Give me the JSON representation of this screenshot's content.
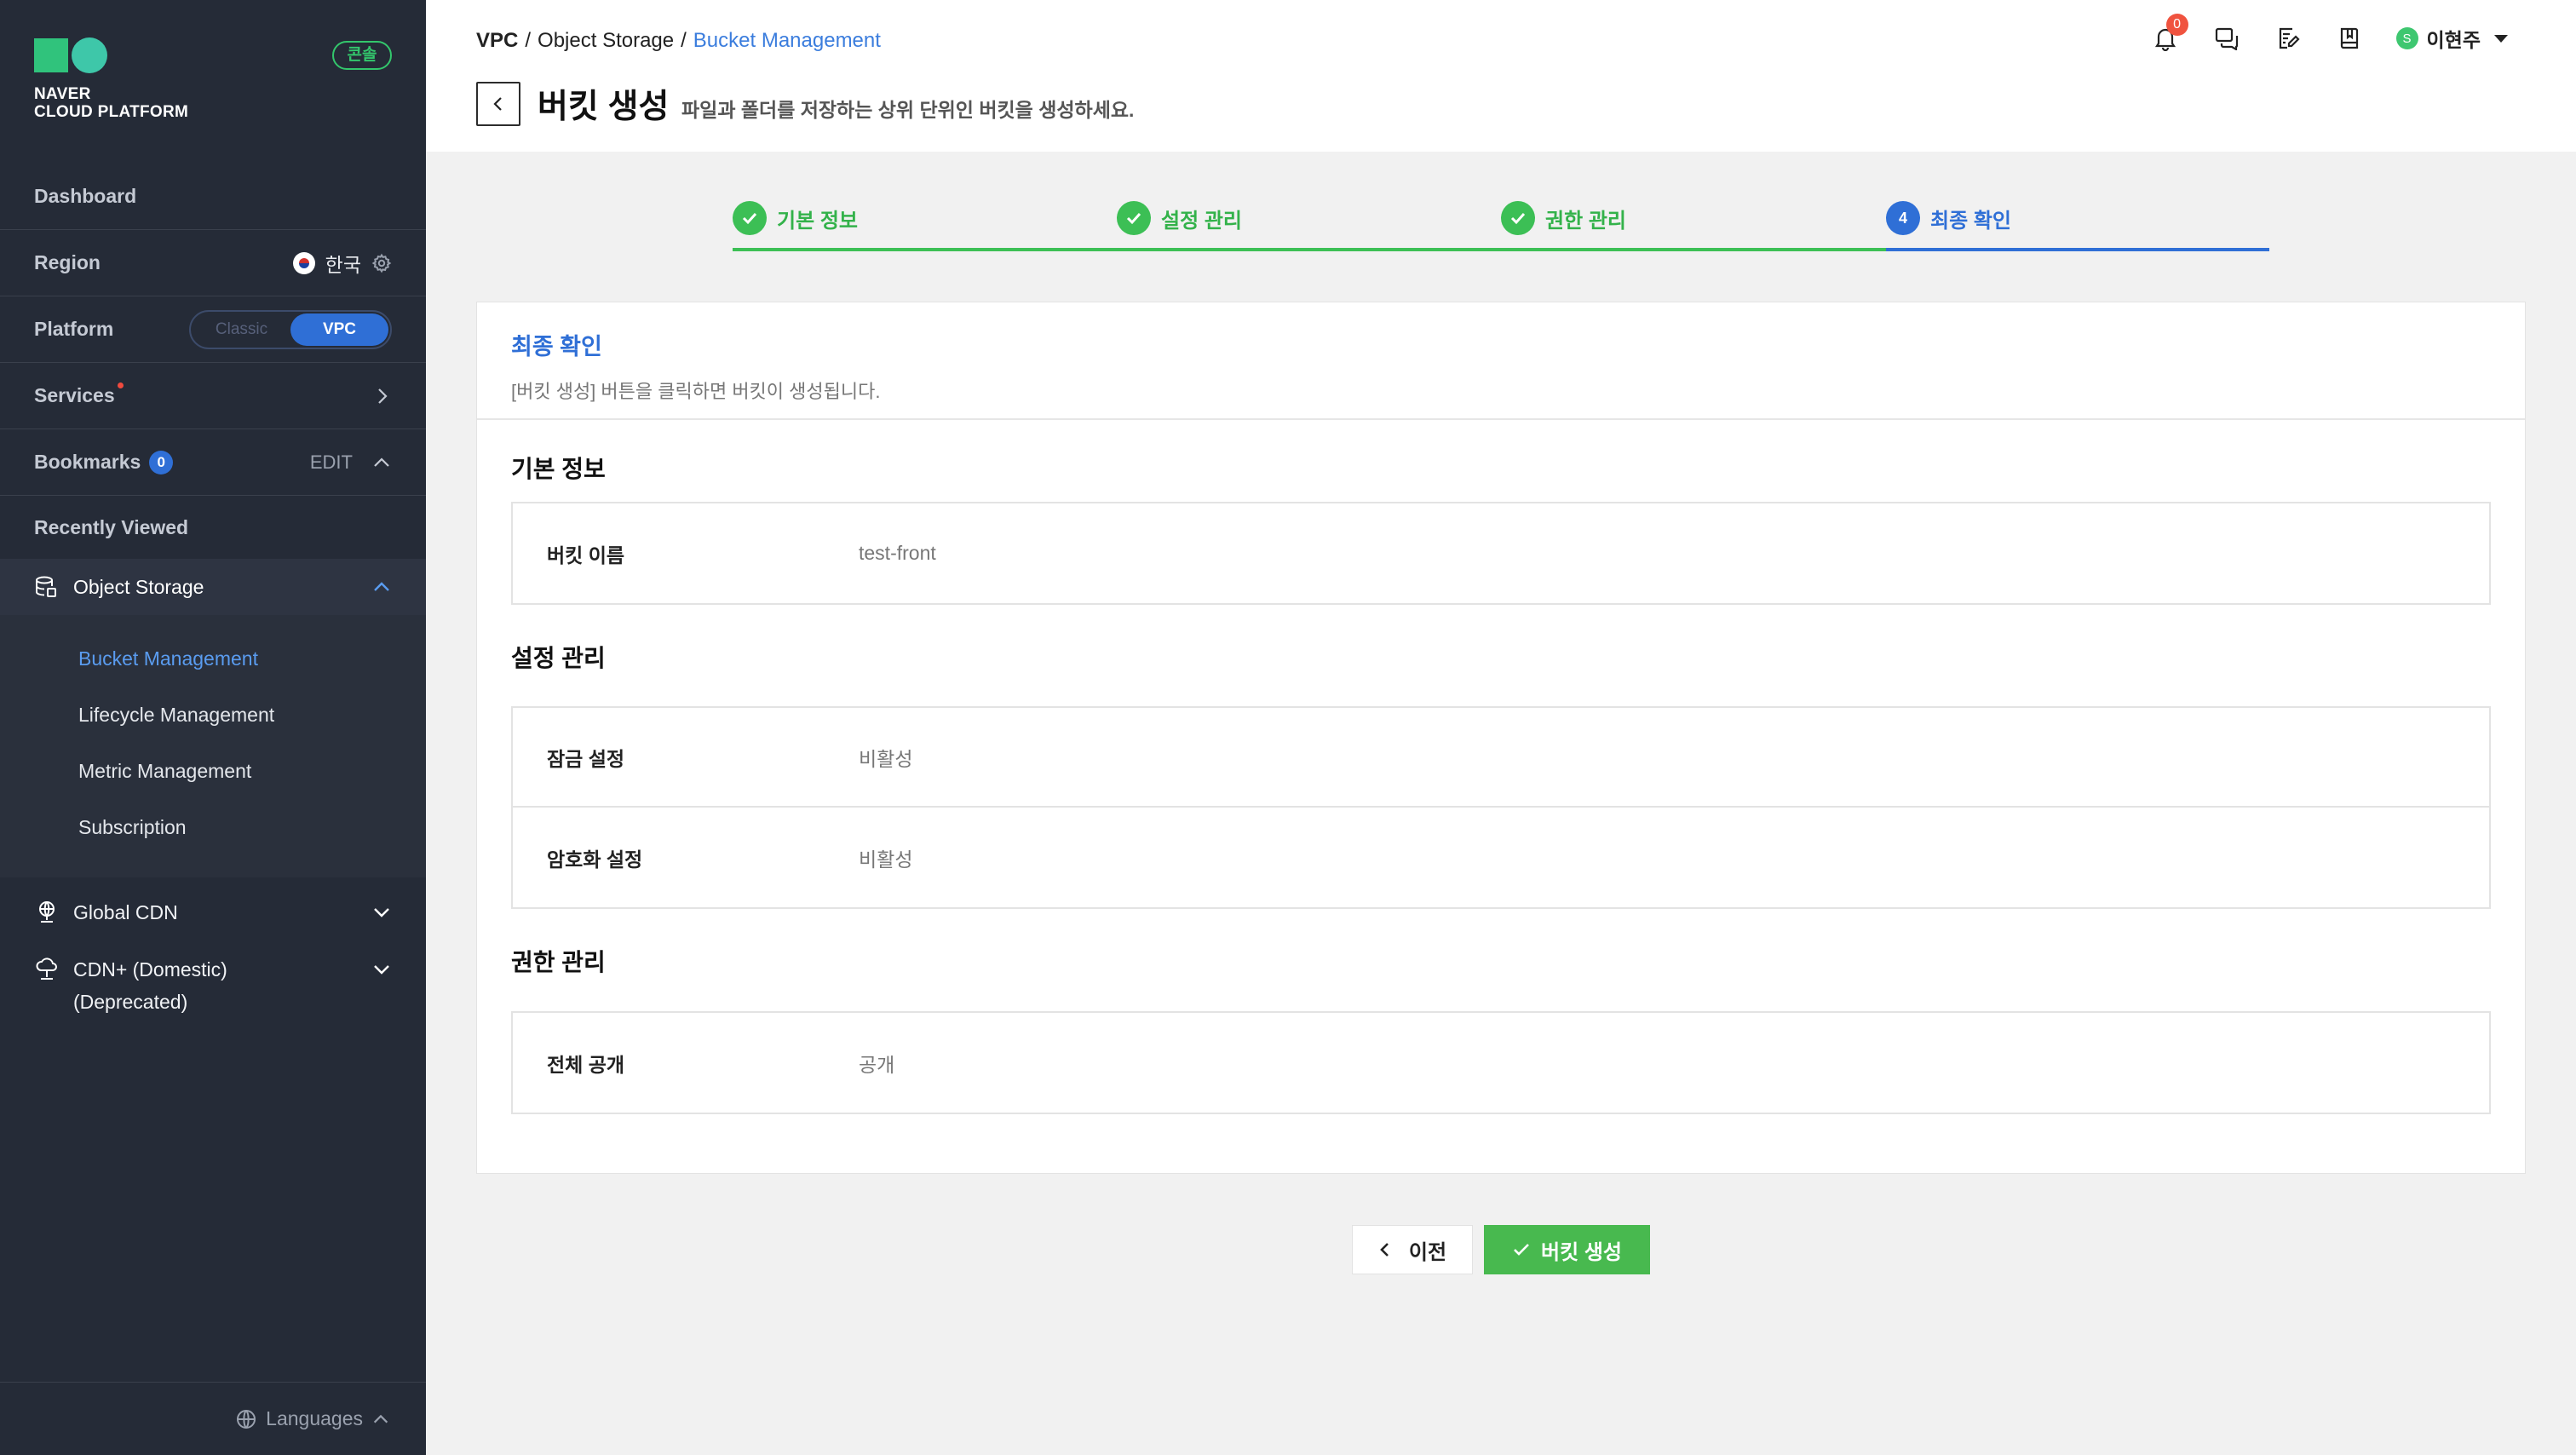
{
  "sidebar": {
    "logo_text": [
      "NAVER",
      "CLOUD PLATFORM"
    ],
    "console_badge": "콘솔",
    "dashboard": "Dashboard",
    "region_label": "Region",
    "region_value": "한국",
    "platform_label": "Platform",
    "platform_options": [
      "Classic",
      "VPC"
    ],
    "platform_selected": "VPC",
    "services_label": "Services",
    "bookmarks_label": "Bookmarks",
    "bookmarks_count": "0",
    "bookmarks_edit": "EDIT",
    "recently_viewed": "Recently Viewed",
    "object_storage": "Object Storage",
    "object_storage_items": [
      "Bucket Management",
      "Lifecycle Management",
      "Metric Management",
      "Subscription"
    ],
    "active_item": "Bucket Management",
    "global_cdn": "Global CDN",
    "cdn_plus_line1": "CDN+ (Domestic)",
    "cdn_plus_line2": "(Deprecated)",
    "languages": "Languages"
  },
  "header": {
    "breadcrumb": [
      "VPC",
      "Object Storage",
      "Bucket Management"
    ],
    "breadcrumb_sep": "/",
    "title": "버킷 생성",
    "description": "파일과 폴더를 저장하는 상위 단위인 버킷을 생성하세요.",
    "notification_count": "0",
    "user_initial": "S",
    "user_name": "이현주"
  },
  "steps": [
    {
      "label": "기본 정보",
      "status": "done"
    },
    {
      "label": "설정 관리",
      "status": "done"
    },
    {
      "label": "권한 관리",
      "status": "done"
    },
    {
      "label": "최종 확인",
      "status": "current",
      "number": "4"
    }
  ],
  "card": {
    "title": "최종 확인",
    "subtitle": "[버킷 생성] 버튼을 클릭하면 버킷이 생성됩니다.",
    "sections": [
      {
        "title": "기본 정보",
        "rows": [
          {
            "key": "버킷 이름",
            "value": "test-front"
          }
        ]
      },
      {
        "title": "설정 관리",
        "rows": [
          {
            "key": "잠금 설정",
            "value": "비활성"
          },
          {
            "key": "암호화 설정",
            "value": "비활성"
          }
        ]
      },
      {
        "title": "권한 관리",
        "rows": [
          {
            "key": "전체 공개",
            "value": "공개"
          }
        ]
      }
    ]
  },
  "buttons": {
    "prev": "이전",
    "create": "버킷 생성"
  },
  "colors": {
    "sidebar_bg": "#252b37",
    "accent_blue": "#2f6fd6",
    "accent_green": "#48b94f",
    "notification_red": "#f0533f"
  }
}
